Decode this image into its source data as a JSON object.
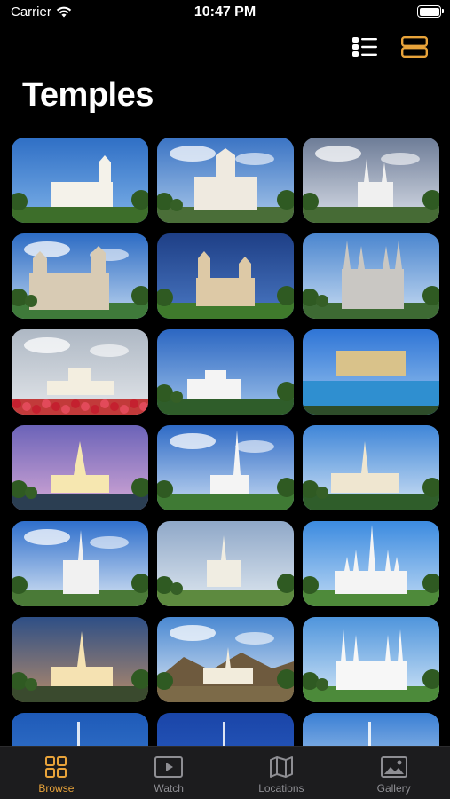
{
  "status_bar": {
    "carrier": "Carrier",
    "time": "10:47 PM"
  },
  "page": {
    "title": "Temples"
  },
  "view_toggle": {
    "list_icon": "list-icon",
    "grid_icon": "card-grid-icon",
    "active": "grid"
  },
  "colors": {
    "accent": "#e8a33a",
    "tab_bar": "#1c1c1e",
    "inactive": "#8e8e93",
    "background": "#000000"
  },
  "tiles": [
    {
      "sky": [
        "#2f6fc5",
        "#7db1e8"
      ],
      "ground": "#3d6e2a",
      "building": "#f4f2ea",
      "style": "tower-left"
    },
    {
      "sky": [
        "#3b74c4",
        "#a9c8ea"
      ],
      "ground": "#4a6e38",
      "building": "#efeae0",
      "style": "dome"
    },
    {
      "sky": [
        "#6d7c97",
        "#d9dee8"
      ],
      "ground": "#466b35",
      "building": "#f0f0f0",
      "style": "spires-far"
    },
    {
      "sky": [
        "#2d6cc4",
        "#bcd4ef"
      ],
      "ground": "#3f7a3a",
      "building": "#d8cbb4",
      "style": "cathedral"
    },
    {
      "sky": [
        "#1e3f86",
        "#4a78c3"
      ],
      "ground": "#3f7a2c",
      "building": "#ddc9a6",
      "style": "twin-tower"
    },
    {
      "sky": [
        "#4b86cf",
        "#c8dcf2"
      ],
      "ground": "#3d6a33",
      "building": "#c9c7c3",
      "style": "salt-lake"
    },
    {
      "sky": [
        "#aeb8c4",
        "#e3e6ea"
      ],
      "ground": "#c23a3a",
      "building": "#f3eee0",
      "style": "low-flowers"
    },
    {
      "sky": [
        "#2c67c2",
        "#9ec2ea"
      ],
      "ground": "#2f5d2a",
      "building": "#f4f4f4",
      "style": "flat-modern"
    },
    {
      "sky": [
        "#2f75d6",
        "#9cc7f0"
      ],
      "ground": "#2f8fd0",
      "building": "#d9c28a",
      "style": "pool"
    },
    {
      "sky": [
        "#6b63b8",
        "#d6a9d6"
      ],
      "ground": "#2b3e52",
      "building": "#f6e7b0",
      "style": "spire-dusk"
    },
    {
      "sky": [
        "#2f6bc6",
        "#c8dcf3"
      ],
      "ground": "#3f7a34",
      "building": "#f4f4f4",
      "style": "spire-tall"
    },
    {
      "sky": [
        "#3f86d8",
        "#d3e4f5"
      ],
      "ground": "#2f5d2a",
      "building": "#efe6d0",
      "style": "spire-desert"
    },
    {
      "sky": [
        "#2f6fcc",
        "#d9e6f4"
      ],
      "ground": "#4a7a37",
      "building": "#f1f1f1",
      "style": "spire-clouds"
    },
    {
      "sky": [
        "#8fa8c8",
        "#dfe8f0"
      ],
      "ground": "#5d8a3f",
      "building": "#f0ede2",
      "style": "spire-garden"
    },
    {
      "sky": [
        "#3c8be0",
        "#bfdaf4"
      ],
      "ground": "#4e8a3a",
      "building": "#f4f4f4",
      "style": "multi-spire"
    },
    {
      "sky": [
        "#2e4f86",
        "#b38a6a"
      ],
      "ground": "#3a4a2e",
      "building": "#f5e2b2",
      "style": "spire-dusk-wide"
    },
    {
      "sky": [
        "#4a88d2",
        "#dfe9f3"
      ],
      "ground": "#7c6a48",
      "building": "#f2ecdc",
      "style": "mountain"
    },
    {
      "sky": [
        "#4f95dc",
        "#d3e6f7"
      ],
      "ground": "#4c8a3a",
      "building": "#f7f7f7",
      "style": "dc-spires"
    },
    {
      "sky": [
        "#1e5ab8",
        "#3f7fd1"
      ],
      "ground": "#1e5ab8",
      "building": "#ffffff",
      "style": "partial"
    },
    {
      "sky": [
        "#1a45a8",
        "#2d63c6"
      ],
      "ground": "#1a45a8",
      "building": "#ffffff",
      "style": "partial"
    },
    {
      "sky": [
        "#3a7fd4",
        "#cfe2f5"
      ],
      "ground": "#3a7fd4",
      "building": "#ffffff",
      "style": "partial"
    }
  ],
  "tabs": [
    {
      "id": "browse",
      "label": "Browse",
      "icon": "grid-icon",
      "active": true
    },
    {
      "id": "watch",
      "label": "Watch",
      "icon": "play-icon",
      "active": false
    },
    {
      "id": "locations",
      "label": "Locations",
      "icon": "map-icon",
      "active": false
    },
    {
      "id": "gallery",
      "label": "Gallery",
      "icon": "photo-icon",
      "active": false
    }
  ]
}
